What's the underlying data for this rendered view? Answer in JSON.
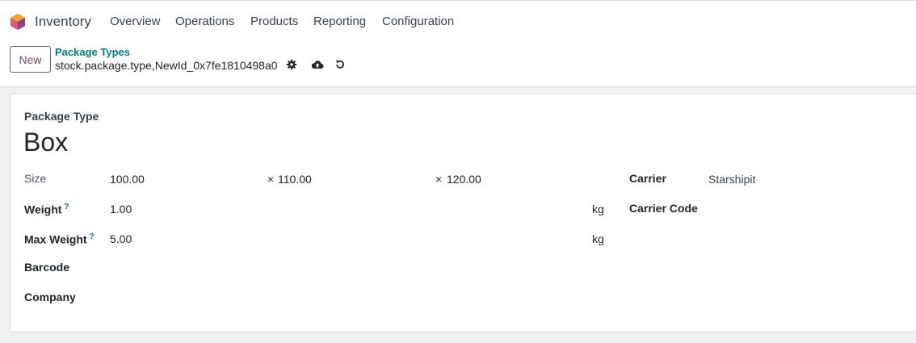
{
  "app": {
    "name": "Inventory"
  },
  "menu": [
    {
      "label": "Overview"
    },
    {
      "label": "Operations"
    },
    {
      "label": "Products"
    },
    {
      "label": "Reporting"
    },
    {
      "label": "Configuration"
    }
  ],
  "control": {
    "new_label": "New",
    "breadcrumb": "Package Types",
    "record_name": "stock.package.type,NewId_0x7fe1810498a0"
  },
  "form": {
    "type_label": "Package Type",
    "type_name": "Box",
    "size": {
      "label": "Size",
      "length": "100.00",
      "width_prefix": "×",
      "width": "110.00",
      "height_prefix": "×",
      "height": "120.00"
    },
    "weight": {
      "label": "Weight",
      "help": "?",
      "value": "1.00",
      "unit": "kg"
    },
    "max_weight": {
      "label": "Max Weight",
      "help": "?",
      "value": "5.00",
      "unit": "kg"
    },
    "barcode": {
      "label": "Barcode",
      "value": ""
    },
    "company": {
      "label": "Company",
      "value": ""
    },
    "carrier": {
      "label": "Carrier",
      "value": "Starshipit"
    },
    "carrier_code": {
      "label": "Carrier Code",
      "value": ""
    }
  },
  "colors": {
    "brand": "#714b67",
    "link": "#017e84"
  }
}
